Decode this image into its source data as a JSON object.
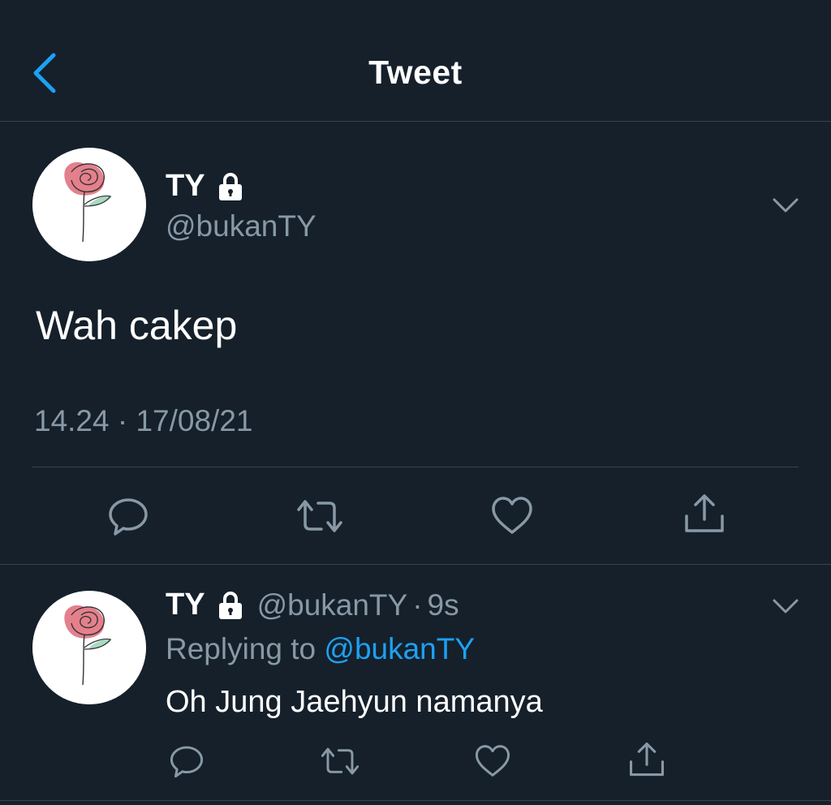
{
  "header": {
    "title": "Tweet",
    "back_icon": "chevron-left-icon"
  },
  "colors": {
    "background": "#15202b",
    "secondary_text": "#8899a6",
    "accent": "#1da1f2",
    "divider": "#38444d"
  },
  "tweet": {
    "author_name": "TY",
    "author_handle": "@bukanTY",
    "protected_icon": "lock-icon",
    "text": "Wah cakep",
    "timestamp": "14.24 · 17/08/21",
    "actions": [
      "reply-icon",
      "retweet-icon",
      "like-icon",
      "share-icon"
    ]
  },
  "reply": {
    "author_name": "TY",
    "author_handle": "@bukanTY",
    "separator": "·",
    "time": "9s",
    "replying_prefix": "Replying to",
    "replying_to": "@bukanTY",
    "text": "Oh Jung Jaehyun namanya",
    "actions": [
      "reply-icon",
      "retweet-icon",
      "like-icon",
      "share-icon"
    ]
  }
}
